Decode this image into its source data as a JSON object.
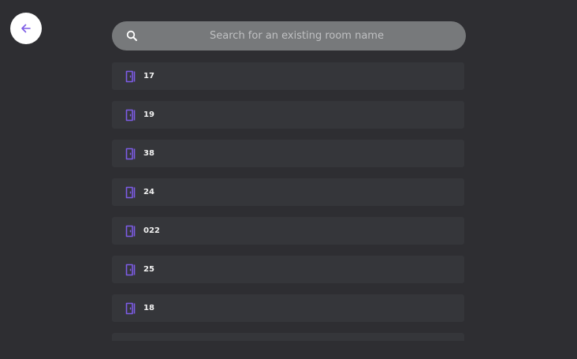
{
  "colors": {
    "background": "#2e2e32",
    "row": "#35363a",
    "search_bg": "#77797b",
    "accent": "#7d5ce6"
  },
  "back_button": {
    "icon": "arrow-left-icon"
  },
  "search": {
    "icon": "search-icon",
    "placeholder": "Search for an existing room name",
    "value": ""
  },
  "rooms": {
    "icon": "door-icon",
    "items": [
      {
        "name": "17"
      },
      {
        "name": "19"
      },
      {
        "name": "38"
      },
      {
        "name": "24"
      },
      {
        "name": "022"
      },
      {
        "name": "25"
      },
      {
        "name": "18"
      }
    ]
  }
}
